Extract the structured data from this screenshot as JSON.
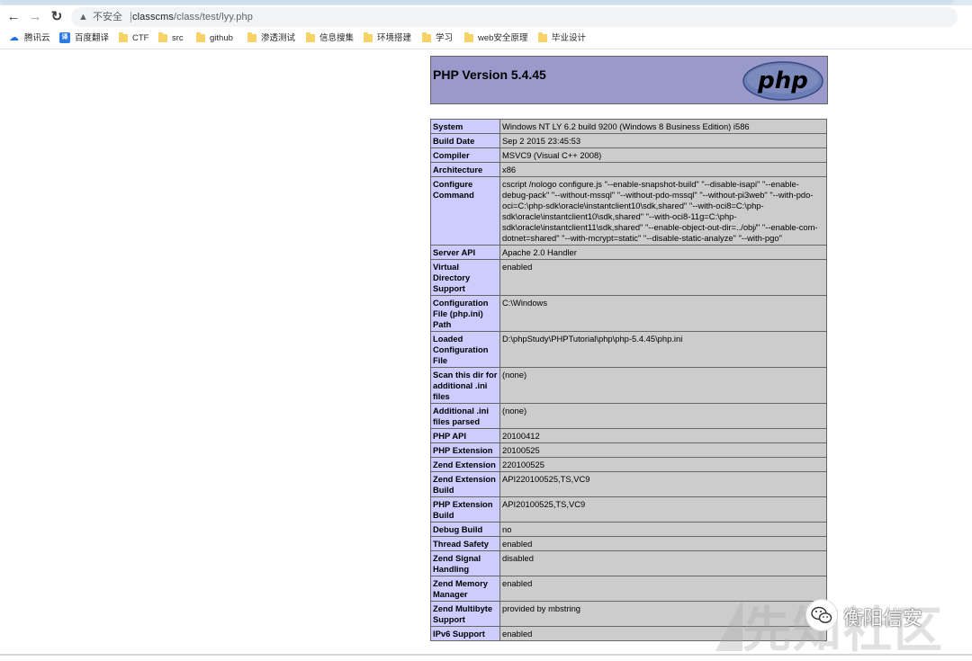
{
  "browser": {
    "insecure_label": "不安全",
    "url_host": "classcms",
    "url_path": "/class/test/lyy.php",
    "bookmarks": [
      {
        "label": "腾讯云",
        "icon": "cloud-icon"
      },
      {
        "label": "百度翻译",
        "icon": "translate-icon"
      },
      {
        "label": "CTF",
        "icon": "folder-icon"
      },
      {
        "label": "src",
        "icon": "folder-icon"
      },
      {
        "label": "github",
        "icon": "folder-icon"
      },
      {
        "label": "渗透测试",
        "icon": "folder-icon"
      },
      {
        "label": "信息搜集",
        "icon": "folder-icon"
      },
      {
        "label": "环境搭建",
        "icon": "folder-icon"
      },
      {
        "label": "学习",
        "icon": "folder-icon"
      },
      {
        "label": "web安全原理",
        "icon": "folder-icon"
      },
      {
        "label": "毕业设计",
        "icon": "folder-icon"
      }
    ]
  },
  "phpinfo": {
    "title": "PHP Version 5.4.45",
    "logo_text": "php",
    "rows": [
      {
        "key": "System",
        "value": "Windows NT LY 6.2 build 9200 (Windows 8 Business Edition) i586"
      },
      {
        "key": "Build Date",
        "value": "Sep 2 2015 23:45:53"
      },
      {
        "key": "Compiler",
        "value": "MSVC9 (Visual C++ 2008)"
      },
      {
        "key": "Architecture",
        "value": "x86"
      },
      {
        "key": "Configure Command",
        "value": "cscript /nologo configure.js \"--enable-snapshot-build\" \"--disable-isapi\" \"--enable-debug-pack\" \"--without-mssql\" \"--without-pdo-mssql\" \"--without-pi3web\" \"--with-pdo-oci=C:\\php-sdk\\oracle\\instantclient10\\sdk,shared\" \"--with-oci8=C:\\php-sdk\\oracle\\instantclient10\\sdk,shared\" \"--with-oci8-11g=C:\\php-sdk\\oracle\\instantclient11\\sdk,shared\" \"--enable-object-out-dir=../obj/\" \"--enable-com-dotnet=shared\" \"--with-mcrypt=static\" \"--disable-static-analyze\" \"--with-pgo\""
      },
      {
        "key": "Server API",
        "value": "Apache 2.0 Handler"
      },
      {
        "key": "Virtual Directory Support",
        "value": "enabled"
      },
      {
        "key": "Configuration File (php.ini) Path",
        "value": "C:\\Windows"
      },
      {
        "key": "Loaded Configuration File",
        "value": "D:\\phpStudy\\PHPTutorial\\php\\php-5.4.45\\php.ini"
      },
      {
        "key": "Scan this dir for additional .ini files",
        "value": "(none)"
      },
      {
        "key": "Additional .ini files parsed",
        "value": "(none)"
      },
      {
        "key": "PHP API",
        "value": "20100412"
      },
      {
        "key": "PHP Extension",
        "value": "20100525"
      },
      {
        "key": "Zend Extension",
        "value": "220100525"
      },
      {
        "key": "Zend Extension Build",
        "value": "API220100525,TS,VC9"
      },
      {
        "key": "PHP Extension Build",
        "value": "API20100525,TS,VC9"
      },
      {
        "key": "Debug Build",
        "value": "no"
      },
      {
        "key": "Thread Safety",
        "value": "enabled"
      },
      {
        "key": "Zend Signal Handling",
        "value": "disabled"
      },
      {
        "key": "Zend Memory Manager",
        "value": "enabled"
      },
      {
        "key": "Zend Multibyte Support",
        "value": "provided by mbstring"
      },
      {
        "key": "IPv6 Support",
        "value": "enabled"
      }
    ]
  },
  "watermark": {
    "account": "衡阳信安",
    "site": "先知社区"
  }
}
